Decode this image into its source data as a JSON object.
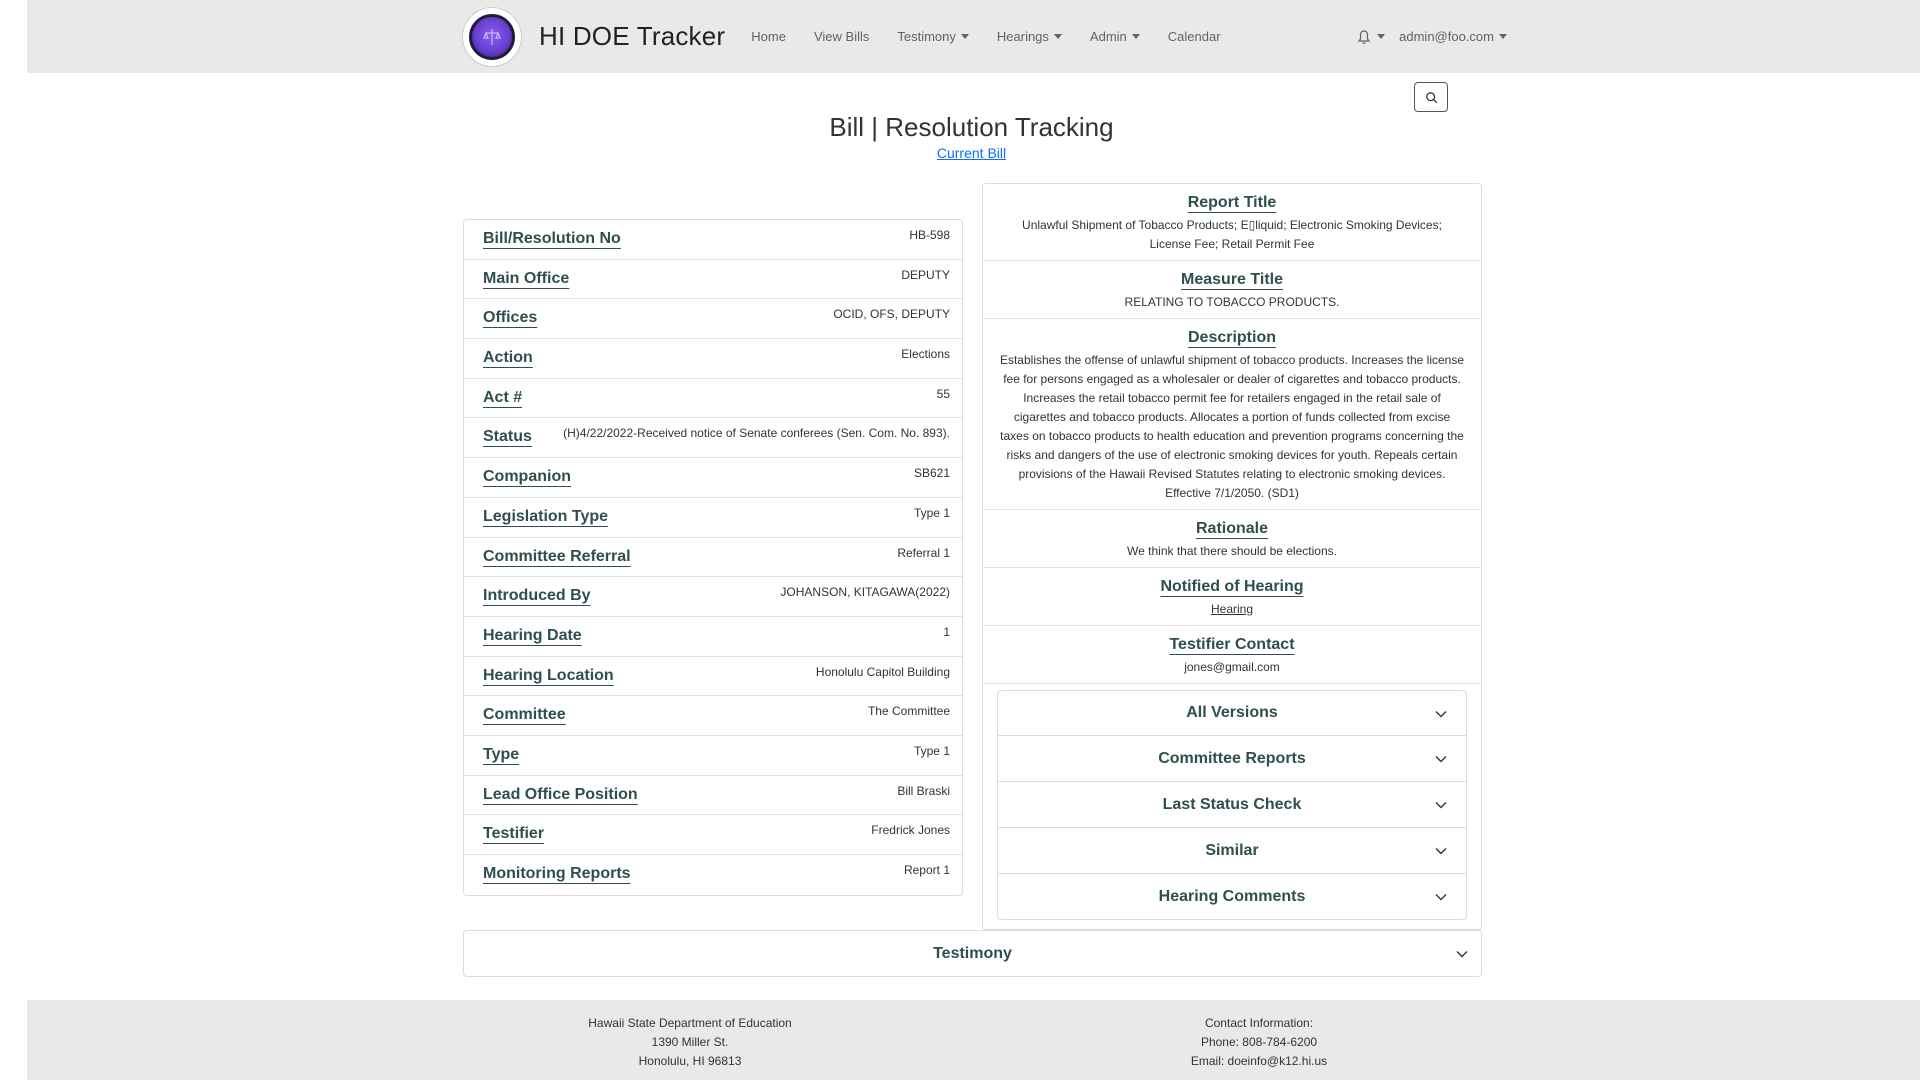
{
  "nav": {
    "brand": "HI DOE Tracker",
    "links": [
      {
        "label": "Home",
        "dropdown": false
      },
      {
        "label": "View Bills",
        "dropdown": false
      },
      {
        "label": "Testimony",
        "dropdown": true
      },
      {
        "label": "Hearings",
        "dropdown": true
      },
      {
        "label": "Admin",
        "dropdown": true
      },
      {
        "label": "Calendar",
        "dropdown": false
      }
    ],
    "user": "admin@foo.com"
  },
  "page": {
    "title": "Bill | Resolution Tracking",
    "current_bill_link": "Current Bill"
  },
  "bill_fields": [
    {
      "label": "Bill/Resolution No",
      "value": "HB-598"
    },
    {
      "label": "Main Office",
      "value": "DEPUTY"
    },
    {
      "label": "Offices",
      "value": "OCID, OFS, DEPUTY"
    },
    {
      "label": "Action",
      "value": "Elections"
    },
    {
      "label": "Act #",
      "value": "55"
    },
    {
      "label": "Status",
      "value": "(H)4/22/2022-Received notice of Senate conferees (Sen. Com. No. 893)."
    },
    {
      "label": "Companion",
      "value": "SB621"
    },
    {
      "label": "Legislation Type",
      "value": "Type 1"
    },
    {
      "label": "Committee Referral",
      "value": "Referral 1"
    },
    {
      "label": "Introduced By",
      "value": "JOHANSON, KITAGAWA(2022)"
    },
    {
      "label": "Hearing Date",
      "value": "1"
    },
    {
      "label": "Hearing Location",
      "value": "Honolulu Capitol Building"
    },
    {
      "label": "Committee",
      "value": "The Committee"
    },
    {
      "label": "Type",
      "value": "Type 1"
    },
    {
      "label": "Lead Office Position",
      "value": "Bill Braski"
    },
    {
      "label": "Testifier",
      "value": "Fredrick Jones"
    },
    {
      "label": "Monitoring Reports",
      "value": "Report 1"
    }
  ],
  "details": {
    "report_title": {
      "label": "Report Title",
      "value": "Unlawful Shipment of Tobacco Products; E▯liquid; Electronic Smoking Devices; License Fee; Retail Permit Fee"
    },
    "measure_title": {
      "label": "Measure Title",
      "value": "RELATING TO TOBACCO PRODUCTS."
    },
    "description": {
      "label": "Description",
      "value": "Establishes the offense of unlawful shipment of tobacco products. Increases the license fee for persons engaged as a wholesaler or dealer of cigarettes and tobacco products. Increases the retail tobacco permit fee for retailers engaged in the retail sale of cigarettes and tobacco products. Allocates a portion of funds collected from excise taxes on tobacco products to health education and prevention programs concerning the risks and dangers of the use of electronic smoking devices for youth. Repeals certain provisions of the Hawaii Revised Statutes relating to electronic smoking devices. Effective 7/1/2050. (SD1)"
    },
    "rationale": {
      "label": "Rationale",
      "value": "We think that there should be elections."
    },
    "notified": {
      "label": "Notified of Hearing",
      "value": "Hearing"
    },
    "testifier_contact": {
      "label": "Testifier Contact",
      "value": "jones@gmail.com"
    }
  },
  "accordions": [
    "All Versions",
    "Committee Reports",
    "Last Status Check",
    "Similar",
    "Hearing Comments"
  ],
  "testimony_label": "Testimony",
  "footer": {
    "address": [
      "Hawaii State Department of Education",
      "1390 Miller St.",
      "Honolulu, HI 96813"
    ],
    "contact": [
      "Contact Information:",
      "Phone: 808-784-6200",
      "Email: doeinfo@k12.hi.us"
    ]
  }
}
